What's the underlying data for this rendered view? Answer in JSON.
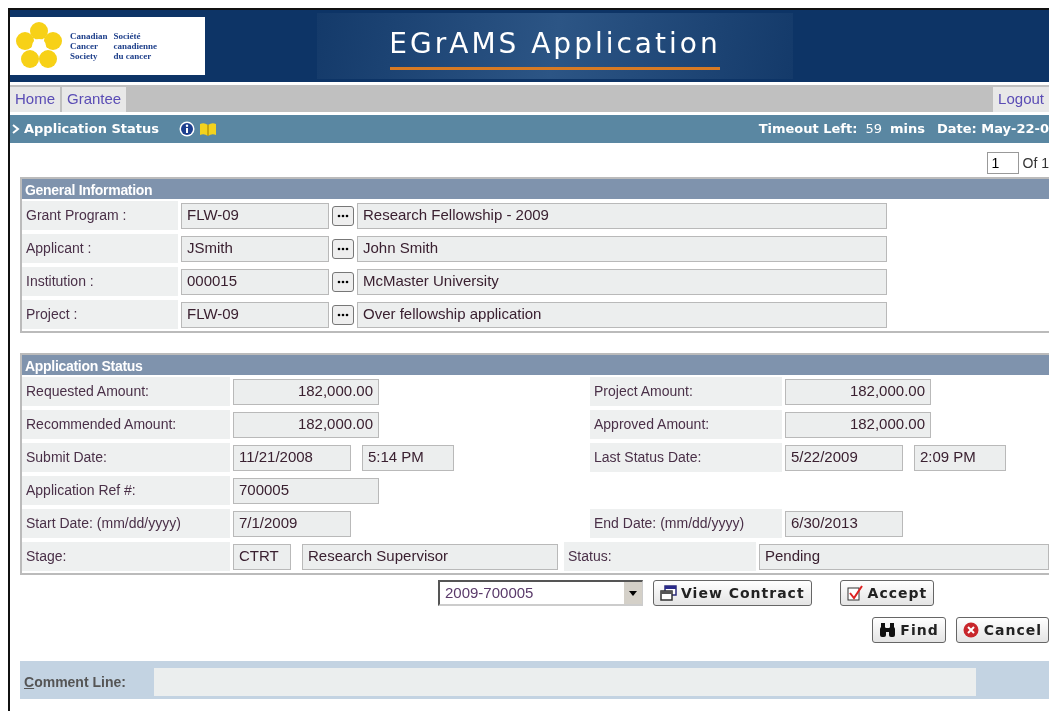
{
  "header": {
    "logo_english": [
      "Canadian",
      "Cancer",
      "Society"
    ],
    "logo_french": [
      "Société",
      "canadienne",
      "du cancer"
    ],
    "title": "EGrAMS Application"
  },
  "nav": {
    "items": [
      {
        "label": "Home"
      },
      {
        "label": "Grantee"
      }
    ],
    "logout": "Logout"
  },
  "status_bar": {
    "title": "Application Status",
    "timeout_label": "Timeout Left:",
    "timeout_value": "59",
    "timeout_unit": "mins",
    "date": "Date: May-22-0"
  },
  "pager": {
    "value": "1",
    "of": "Of 1"
  },
  "general_information": {
    "title": "General Information",
    "rows": [
      {
        "label": "Grant Program :",
        "code": "FLW-09",
        "description": "Research Fellowship - 2009"
      },
      {
        "label": "Applicant :",
        "code": "JSmith",
        "description": "John Smith"
      },
      {
        "label": "Institution :",
        "code": "000015",
        "description": "McMaster University"
      },
      {
        "label": "Project :",
        "code": "FLW-09",
        "description": "Over fellowship application"
      }
    ]
  },
  "application_status": {
    "title": "Application Status",
    "rows": [
      {
        "left": {
          "label": "Requested Amount:",
          "fields": [
            {
              "kind": "amount",
              "value": "182,000.00"
            }
          ]
        },
        "right": {
          "label": "Project Amount:",
          "fields": [
            {
              "kind": "amount",
              "value": "182,000.00"
            }
          ]
        }
      },
      {
        "left": {
          "label": "Recommended Amount:",
          "fields": [
            {
              "kind": "amount",
              "value": "182,000.00"
            }
          ]
        },
        "right": {
          "label": "Approved Amount:",
          "fields": [
            {
              "kind": "amount",
              "value": "182,000.00"
            }
          ]
        }
      },
      {
        "left": {
          "label": "Submit Date:",
          "fields": [
            {
              "kind": "date",
              "value": "11/21/2008"
            },
            {
              "kind": "time",
              "value": "5:14 PM"
            }
          ]
        },
        "right": {
          "label": "Last Status Date:",
          "fields": [
            {
              "kind": "date",
              "value": "5/22/2009"
            },
            {
              "kind": "time",
              "value": "2:09 PM"
            }
          ]
        }
      },
      {
        "left": {
          "label": "Application Ref #:",
          "fields": [
            {
              "kind": "text",
              "value": "700005"
            }
          ]
        }
      },
      {
        "left": {
          "label": "Start Date: (mm/dd/yyyy)",
          "fields": [
            {
              "kind": "date",
              "value": "7/1/2009"
            }
          ]
        },
        "right": {
          "label": "End Date: (mm/dd/yyyy)",
          "fields": [
            {
              "kind": "date",
              "value": "6/30/2013"
            }
          ]
        }
      },
      {
        "left": {
          "label": "Stage:",
          "fields": [
            {
              "kind": "code",
              "value": "CTRT"
            },
            {
              "kind": "long",
              "value": "Research Supervisor"
            }
          ]
        },
        "right": {
          "label": "Status:",
          "fields": [
            {
              "kind": "long",
              "value": "Pending"
            }
          ]
        }
      }
    ]
  },
  "actions": {
    "contract_select": {
      "value": "2009-700005"
    },
    "row_1": [
      {
        "kind": "view",
        "label": "View Contract"
      },
      {
        "kind": "accept",
        "label": "Accept"
      }
    ],
    "row_2": [
      {
        "kind": "find",
        "label": "Find"
      },
      {
        "kind": "cancel",
        "label": "Cancel"
      }
    ]
  },
  "comment_line": {
    "label": "Comment Line:"
  }
}
